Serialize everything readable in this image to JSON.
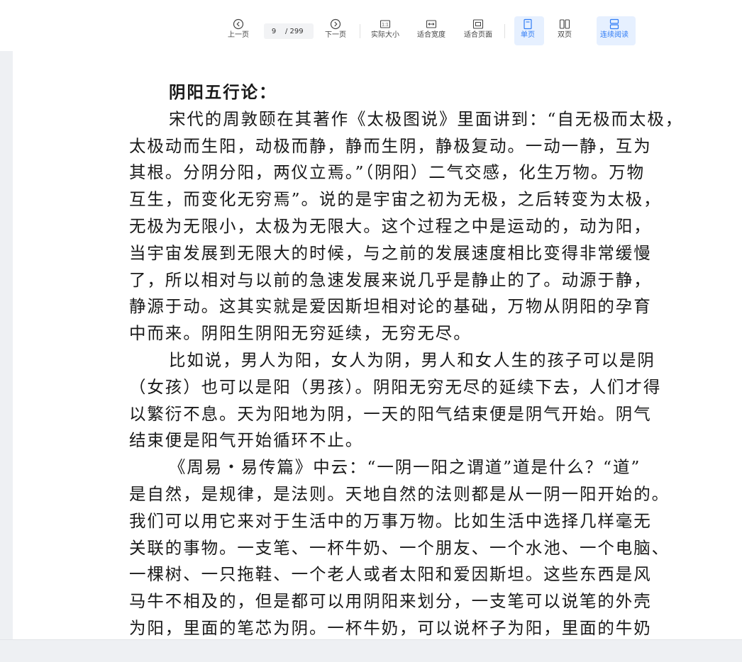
{
  "toolbar": {
    "prev_label": "上一页",
    "page_current": "9",
    "page_total": "/ 299",
    "next_label": "下一页",
    "actual_size_label": "实际大小",
    "fit_width_label": "适合宽度",
    "fit_page_label": "适合页面",
    "single_page_label": "单页",
    "double_page_label": "双页",
    "continuous_label": "连续阅读",
    "actual_size_icon_text": "1:1",
    "accent_color": "#2f7bf5"
  },
  "document": {
    "lines": [
      {
        "text": "阴阳五行论：",
        "indent": true,
        "heading": true
      },
      {
        "text": "宋代的周敦颐在其著作《太极图说》里面讲到：“自无极而太极，",
        "indent": true
      },
      {
        "text": "太极动而生阳，动极而静，静而生阴，静极复动。一动一静，互为",
        "indent": false
      },
      {
        "text": "其根。分阴分阳，两仪立焉。”（阴阳）二气交感，化生万物。万物",
        "indent": false
      },
      {
        "text": "互生，而变化无穷焉”。说的是宇宙之初为无极，之后转变为太极，",
        "indent": false
      },
      {
        "text": "无极为无限小，太极为无限大。这个过程之中是运动的，动为阳，",
        "indent": false
      },
      {
        "text": "当宇宙发展到无限大的时候，与之前的发展速度相比变得非常缓慢",
        "indent": false
      },
      {
        "text": "了，所以相对与以前的急速发展来说几乎是静止的了。动源于静，",
        "indent": false
      },
      {
        "text": "静源于动。这其实就是爱因斯坦相对论的基础，万物从阴阳的孕育",
        "indent": false
      },
      {
        "text": "中而来。阴阳生阴阳无穷延续，无穷无尽。",
        "indent": false
      },
      {
        "text": "比如说，男人为阳，女人为阴，男人和女人生的孩子可以是阴",
        "indent": true
      },
      {
        "text": "（女孩）也可以是阳（男孩）。阴阳无穷无尽的延续下去，人们才得",
        "indent": false
      },
      {
        "text": "以繁衍不息。天为阳地为阴，一天的阳气结束便是阴气开始。阴气",
        "indent": false
      },
      {
        "text": "结束便是阳气开始循环不止。",
        "indent": false
      },
      {
        "text": "《周易・易传篇》中云：“一阴一阳之谓道”道是什么？“道”",
        "indent": true
      },
      {
        "text": "是自然，是规律，是法则。天地自然的法则都是从一阴一阳开始的。",
        "indent": false
      },
      {
        "text": "我们可以用它来对于生活中的万事万物。比如生活中选择几样毫无",
        "indent": false
      },
      {
        "text": "关联的事物。一支笔、一杯牛奶、一个朋友、一个水池、一个电脑、",
        "indent": false
      },
      {
        "text": "一棵树、一只拖鞋、一个老人或者太阳和爱因斯坦。这些东西是风",
        "indent": false
      },
      {
        "text": "马牛不相及的，但是都可以用阴阳来划分，一支笔可以说笔的外壳",
        "indent": false
      },
      {
        "text": "为阳，里面的笔芯为阴。一杯牛奶，可以说杯子为阳，里面的牛奶",
        "indent": false
      }
    ]
  }
}
